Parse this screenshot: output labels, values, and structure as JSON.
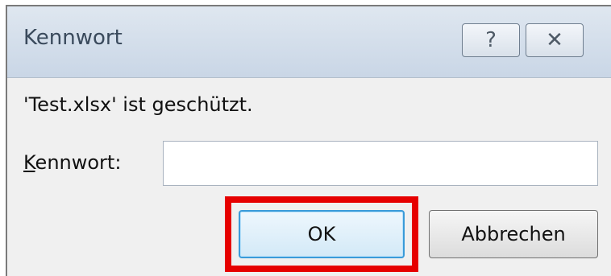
{
  "window": {
    "title": "Kennwort",
    "help_label": "?",
    "close_label": "✕"
  },
  "message": "'Test.xlsx' ist geschützt.",
  "password": {
    "label_mnemonic": "K",
    "label_rest": "ennwort:",
    "value": ""
  },
  "buttons": {
    "ok": "OK",
    "cancel": "Abbrechen"
  },
  "annotation": {
    "highlight_color": "#e60000"
  }
}
